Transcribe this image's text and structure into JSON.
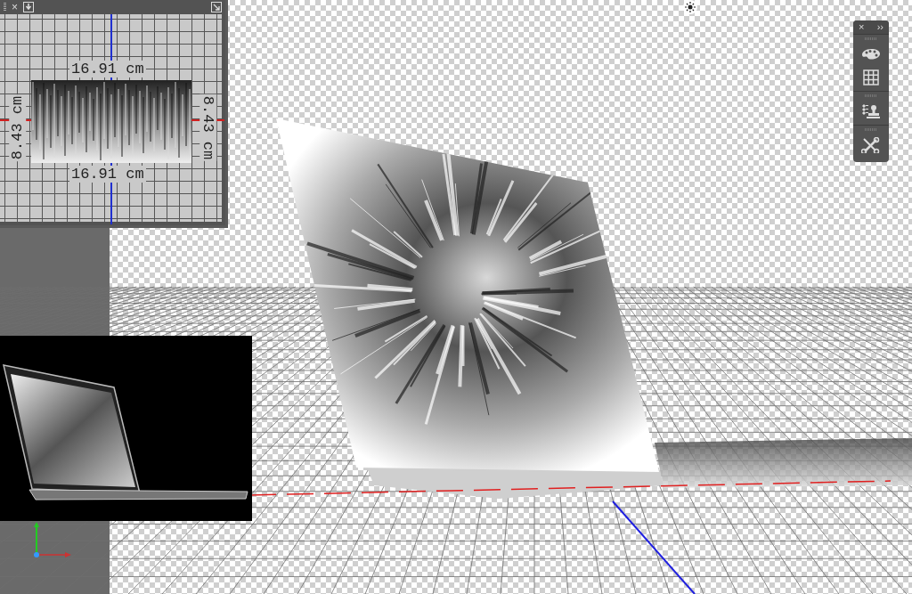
{
  "secondary_view": {
    "close": "×",
    "measurements": {
      "top": "16.91 cm",
      "bottom": "16.91 cm",
      "left": "8.43 cm",
      "right": "8.43 cm"
    }
  },
  "toolbar": {
    "close": "×",
    "expand": "››",
    "tools": [
      {
        "kind": "palette"
      },
      {
        "kind": "grid"
      },
      {
        "kind": "stamp"
      },
      {
        "kind": "tools"
      }
    ]
  }
}
